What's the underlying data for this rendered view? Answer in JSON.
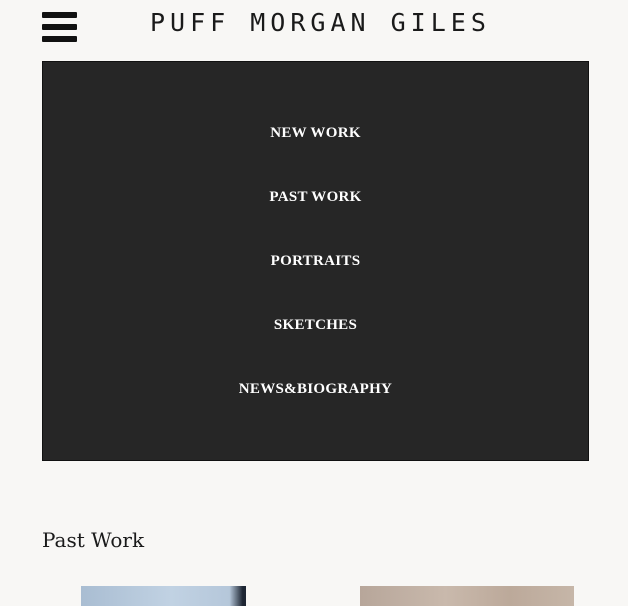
{
  "header": {
    "site_title": "PUFF MORGAN GILES"
  },
  "menu": {
    "items": [
      {
        "label": "NEW WORK"
      },
      {
        "label": "PAST WORK"
      },
      {
        "label": "PORTRAITS"
      },
      {
        "label": "SKETCHES"
      },
      {
        "label": "NEWS&BIOGRAPHY"
      }
    ]
  },
  "main": {
    "section_title": "Past Work"
  },
  "colors": {
    "background": "#f8f7f5",
    "menu_background": "#262626",
    "menu_text": "#ffffff",
    "text": "#1a1a1a"
  },
  "icons": {
    "menu_toggle": "hamburger-menu-icon"
  }
}
